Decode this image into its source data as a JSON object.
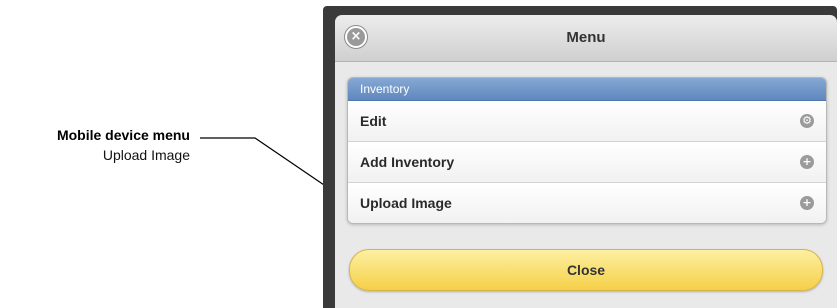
{
  "annotation": {
    "title": "Mobile device menu",
    "subtitle": "Upload Image"
  },
  "dialog": {
    "title": "Menu",
    "close_icon": "close-x-circle-icon",
    "section_header": "Inventory",
    "items": [
      {
        "label": "Edit",
        "icon": "gear-icon",
        "glyph": "⚙"
      },
      {
        "label": "Add Inventory",
        "icon": "plus-icon",
        "glyph": "+"
      },
      {
        "label": "Upload Image",
        "icon": "plus-icon",
        "glyph": "+"
      }
    ],
    "close_button_label": "Close"
  },
  "colors": {
    "divider": "#5f88be",
    "close_button": "#f5cf47",
    "frame": "#3a3a3a"
  }
}
